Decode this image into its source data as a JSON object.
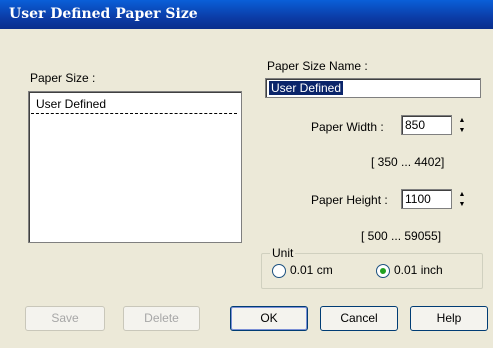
{
  "window": {
    "title": "User Defined Paper Size"
  },
  "paper_size": {
    "label": "Paper Size :",
    "items": [
      "User Defined"
    ]
  },
  "paper_size_name": {
    "label": "Paper Size Name :",
    "value": "User Defined"
  },
  "paper_width": {
    "label": "Paper Width :",
    "value": "850",
    "range": "[ 350 ...  4402]"
  },
  "paper_height": {
    "label": "Paper Height :",
    "value": "1100",
    "range": "[ 500 ... 59055]"
  },
  "unit": {
    "label": "Unit",
    "options": [
      "0.01 cm",
      "0.01 inch"
    ],
    "selected": "0.01 inch"
  },
  "buttons": {
    "save": "Save",
    "delete": "Delete",
    "ok": "OK",
    "cancel": "Cancel",
    "help": "Help"
  }
}
